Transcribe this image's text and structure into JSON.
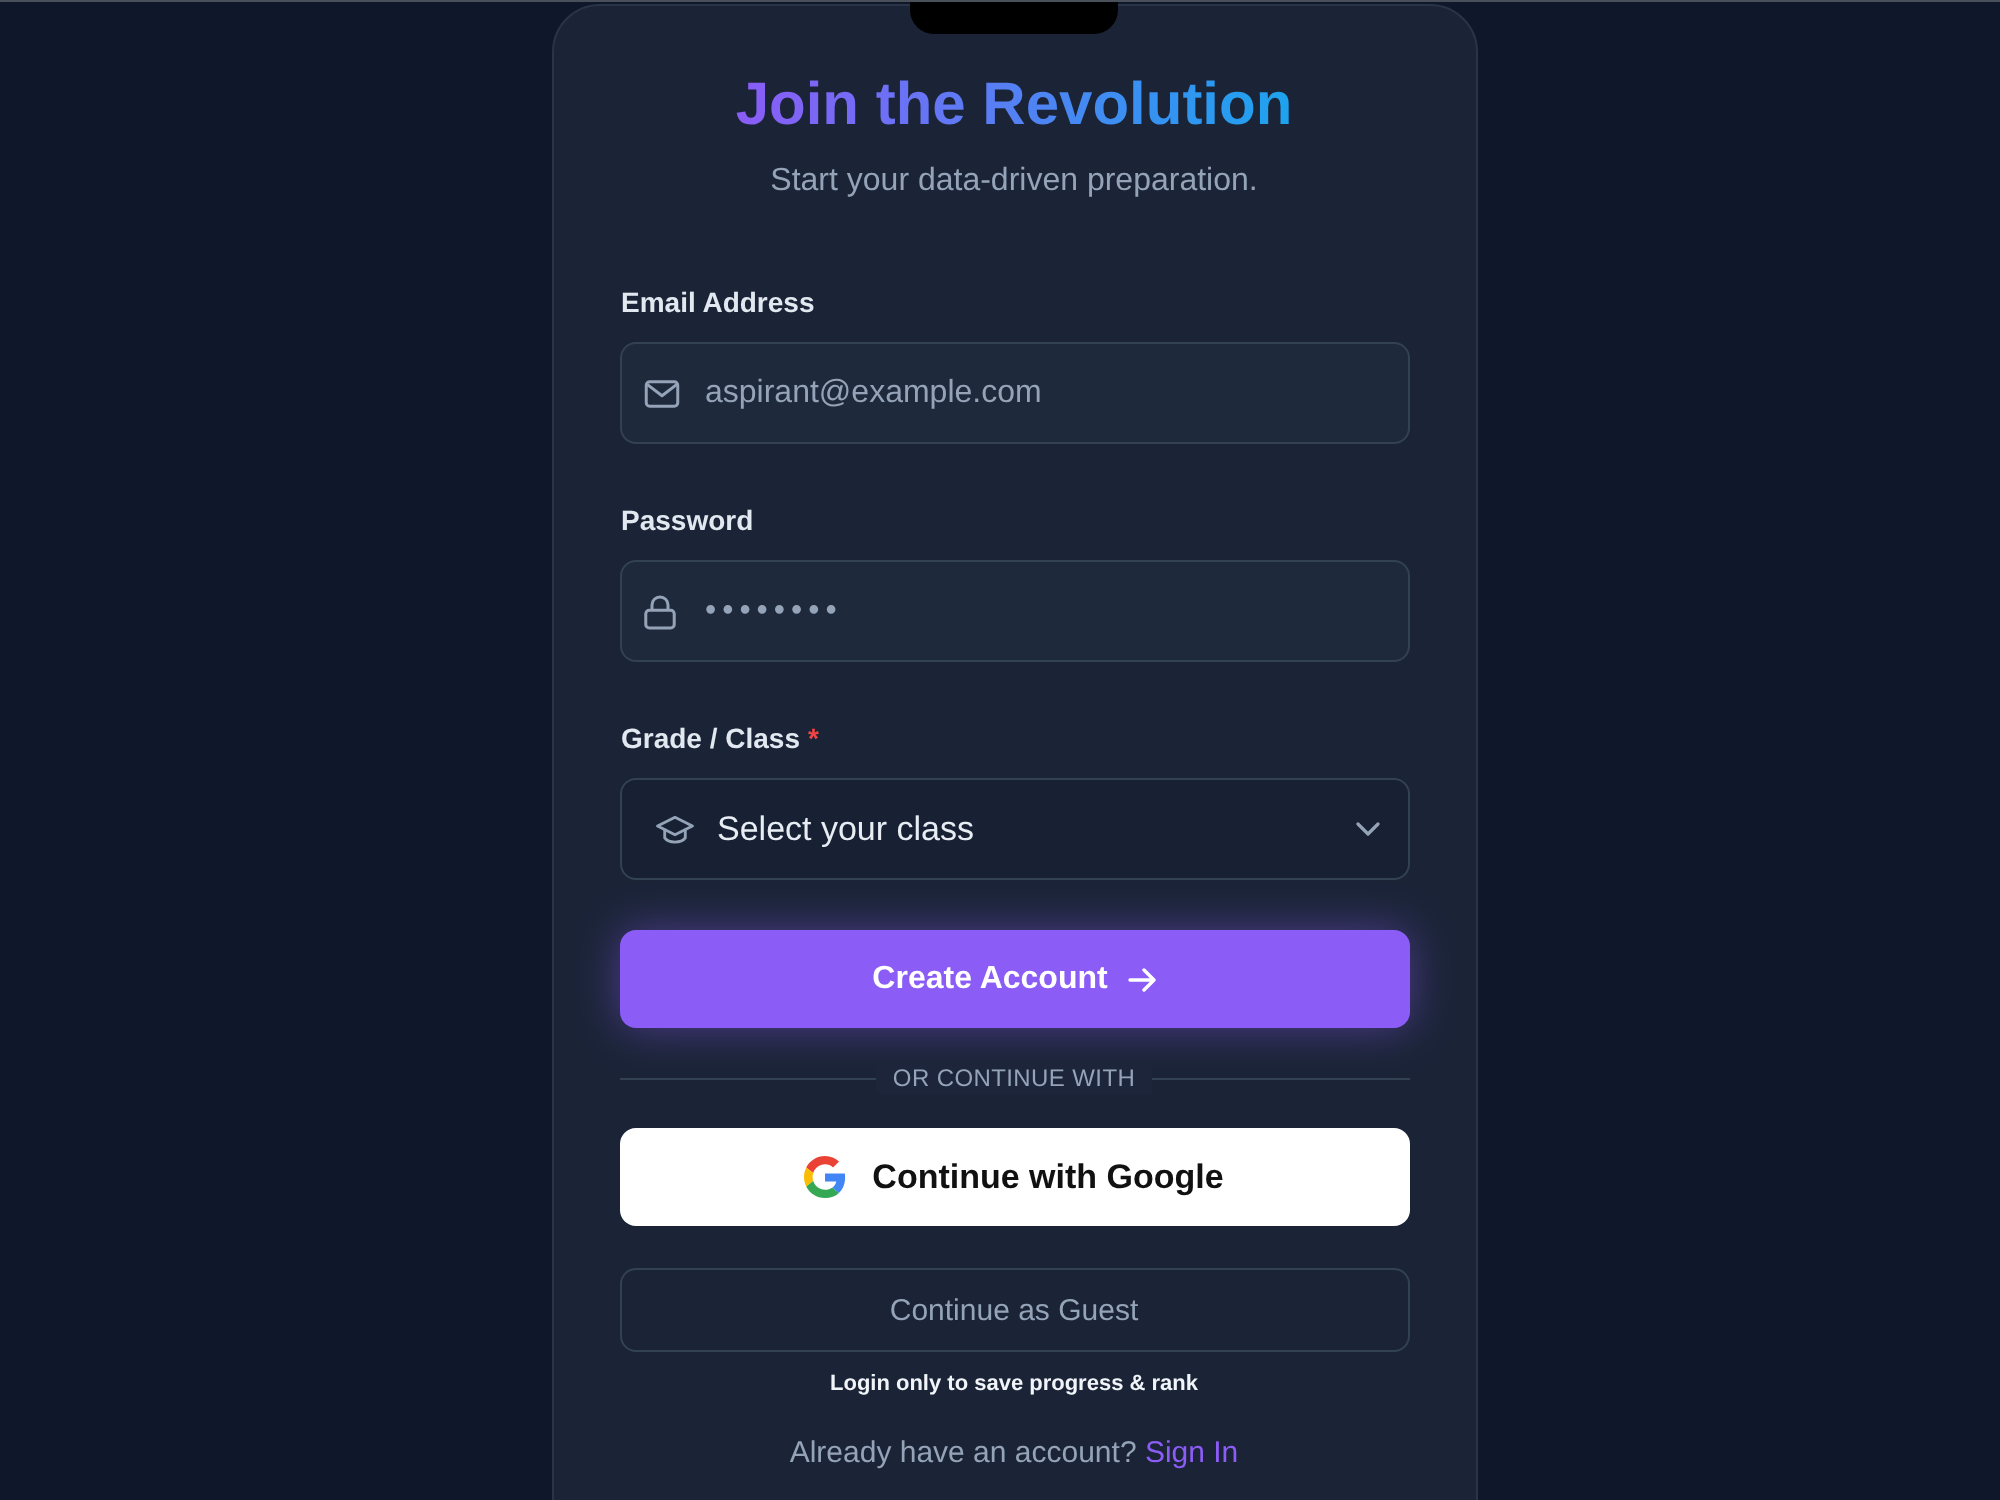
{
  "card": {
    "title": "Join the Revolution",
    "subtitle": "Start your data-driven preparation."
  },
  "fields": [
    {
      "kind": "email",
      "label": "Email Address",
      "placeholder": "aspirant@example.com"
    },
    {
      "kind": "password",
      "label": "Password",
      "placeholder": "••••••••"
    },
    {
      "kind": "select",
      "label": "Grade / Class",
      "required_mark": "*",
      "value": "Select your class"
    }
  ],
  "primary_button": {
    "label": "Create Account"
  },
  "divider": {
    "label": "OR CONTINUE WITH"
  },
  "google_button": {
    "label": "Continue with Google"
  },
  "guest_button": {
    "label": "Continue as Guest"
  },
  "note": "Login only to save progress & rank",
  "footer": {
    "prompt": "Already have an account?",
    "link": "Sign In"
  }
}
